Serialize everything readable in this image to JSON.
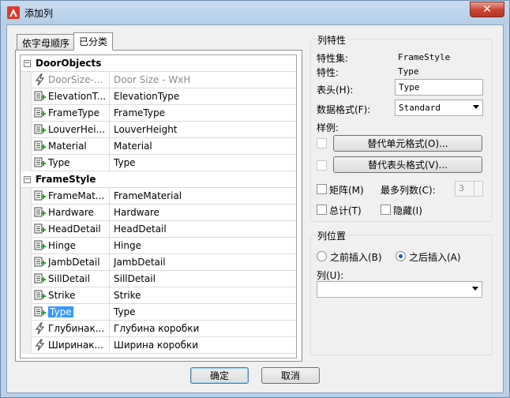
{
  "window": {
    "title": "添加列",
    "close_glyph": "✕"
  },
  "tabs": [
    {
      "label": "依字母顺序",
      "active": false
    },
    {
      "label": "已分类",
      "active": true
    }
  ],
  "grid": {
    "categories": [
      {
        "name": "DoorObjects",
        "toggle": "−",
        "rows": [
          {
            "name": "DoorSize-...",
            "value": "Door Size - WxH",
            "icon": "formula-icon",
            "dim": true
          },
          {
            "name": "ElevationT...",
            "value": "ElevationType",
            "icon": "add-property-icon"
          },
          {
            "name": "FrameType",
            "value": "FrameType",
            "icon": "add-property-icon"
          },
          {
            "name": "LouverHei...",
            "value": "LouverHeight",
            "icon": "add-property-icon"
          },
          {
            "name": "Material",
            "value": "Material",
            "icon": "add-property-icon"
          },
          {
            "name": "Type",
            "value": "Type",
            "icon": "add-property-icon"
          }
        ]
      },
      {
        "name": "FrameStyle",
        "toggle": "−",
        "rows": [
          {
            "name": "FrameMat...",
            "value": "FrameMaterial",
            "icon": "add-property-icon"
          },
          {
            "name": "Hardware",
            "value": "Hardware",
            "icon": "add-property-icon"
          },
          {
            "name": "HeadDetail",
            "value": "HeadDetail",
            "icon": "add-property-icon"
          },
          {
            "name": "Hinge",
            "value": "Hinge",
            "icon": "add-property-icon"
          },
          {
            "name": "JambDetail",
            "value": "JambDetail",
            "icon": "add-property-icon"
          },
          {
            "name": "SillDetail",
            "value": "SillDetail",
            "icon": "add-property-icon"
          },
          {
            "name": "Strike",
            "value": "Strike",
            "icon": "add-property-icon"
          },
          {
            "name": "Type",
            "value": "Type",
            "icon": "add-property-icon",
            "selected": true
          },
          {
            "name": "Глубинак...",
            "value": "Глубина коробки",
            "icon": "formula-icon"
          },
          {
            "name": "Ширинак...",
            "value": "Ширина коробки",
            "icon": "formula-icon"
          }
        ]
      }
    ]
  },
  "column_props": {
    "title": "列特性",
    "set_label": "特性集:",
    "set_value": "FrameStyle",
    "prop_label": "特性:",
    "prop_value": "Type",
    "header_label": "表头(H):",
    "header_value": "Type",
    "format_label": "数据格式(F):",
    "format_value": "Standard",
    "sample_label": "样例:",
    "override_cell_btn": "替代单元格式(O)...",
    "override_header_btn": "替代表头格式(V)...",
    "matrix_label": "矩阵(M)",
    "max_cols_label": "最多列数(C):",
    "max_cols_value": "3",
    "total_label": "总计(T)",
    "hide_label": "隐藏(I)"
  },
  "column_position": {
    "title": "列位置",
    "before_label": "之前插入(B)",
    "after_label": "之后插入(A)",
    "selected": "after",
    "column_label": "列(U):",
    "column_value": ""
  },
  "buttons": {
    "ok": "确定",
    "cancel": "取消"
  }
}
